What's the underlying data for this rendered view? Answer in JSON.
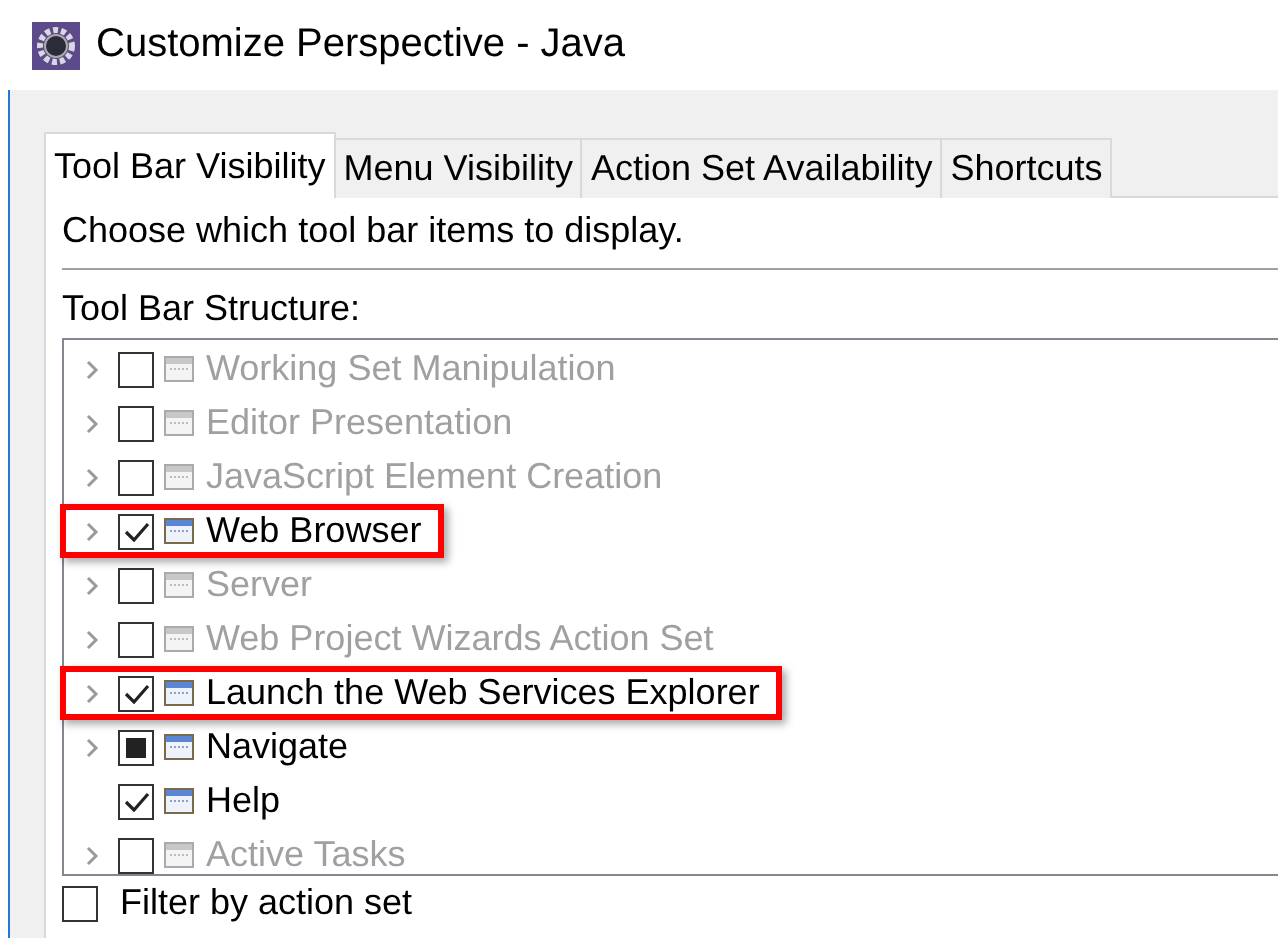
{
  "window": {
    "title": "Customize Perspective - Java"
  },
  "tabs": [
    {
      "label": "Tool Bar Visibility",
      "selected": true
    },
    {
      "label": "Menu Visibility",
      "selected": false
    },
    {
      "label": "Action Set Availability",
      "selected": false
    },
    {
      "label": "Shortcuts",
      "selected": false
    }
  ],
  "description": "Choose which tool bar items to display.",
  "tree": {
    "heading": "Tool Bar Structure:",
    "items": [
      {
        "label": "Working Set Manipulation",
        "expandable": true,
        "checked": false,
        "partial": false,
        "disabled": true,
        "highlighted": false
      },
      {
        "label": "Editor Presentation",
        "expandable": true,
        "checked": false,
        "partial": false,
        "disabled": true,
        "highlighted": false
      },
      {
        "label": "JavaScript Element Creation",
        "expandable": true,
        "checked": false,
        "partial": false,
        "disabled": true,
        "highlighted": false
      },
      {
        "label": "Web Browser",
        "expandable": true,
        "checked": true,
        "partial": false,
        "disabled": false,
        "highlighted": true
      },
      {
        "label": "Server",
        "expandable": true,
        "checked": false,
        "partial": false,
        "disabled": true,
        "highlighted": false
      },
      {
        "label": "Web Project Wizards Action Set",
        "expandable": true,
        "checked": false,
        "partial": false,
        "disabled": true,
        "highlighted": false
      },
      {
        "label": "Launch the Web Services Explorer",
        "expandable": true,
        "checked": true,
        "partial": false,
        "disabled": false,
        "highlighted": true
      },
      {
        "label": "Navigate",
        "expandable": true,
        "checked": false,
        "partial": true,
        "disabled": false,
        "highlighted": false
      },
      {
        "label": "Help",
        "expandable": false,
        "checked": true,
        "partial": false,
        "disabled": false,
        "highlighted": false
      },
      {
        "label": "Active Tasks",
        "expandable": true,
        "checked": false,
        "partial": false,
        "disabled": true,
        "highlighted": false
      }
    ]
  },
  "filter": {
    "label": "Filter by action set",
    "checked": false
  }
}
